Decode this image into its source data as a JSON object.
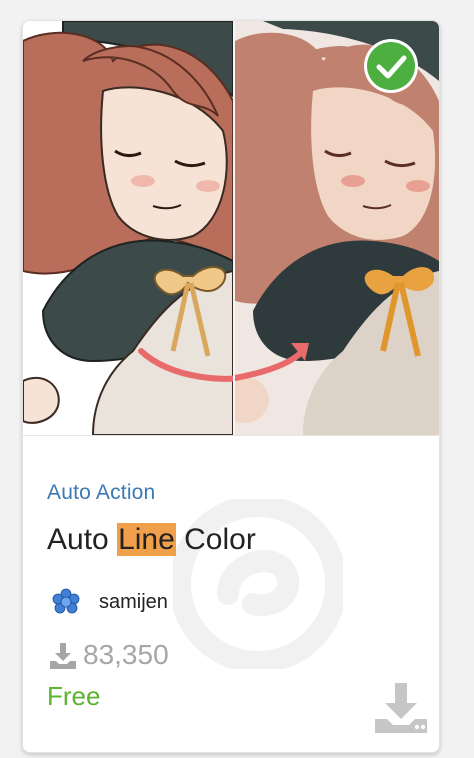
{
  "card": {
    "category": "Auto Action",
    "title_before": "Auto ",
    "title_highlight": "Line",
    "title_after": " Color",
    "author": "samijen",
    "downloads": "83,350",
    "price": "Free"
  },
  "icons": {
    "check_badge": "check-circle-icon",
    "download_count": "download-icon",
    "download_button": "download-icon",
    "avatar": "blue-flower-icon",
    "watermark": "logo-watermark"
  },
  "colors": {
    "category": "#3c79b5",
    "highlight": "#f0a04b",
    "price": "#5cb431",
    "check_badge": "#4caf3f",
    "count": "#a6a6a6"
  }
}
